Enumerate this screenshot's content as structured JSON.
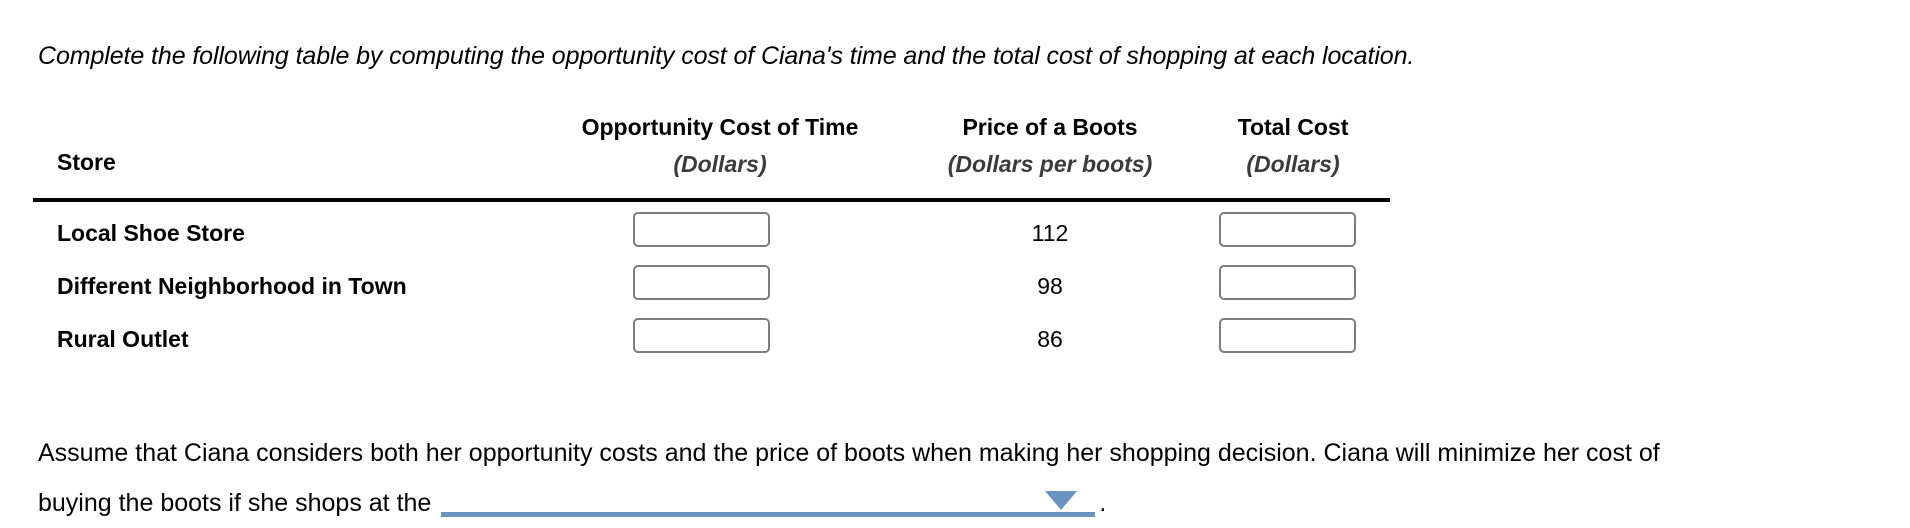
{
  "intro": {
    "text": "Complete the following table by computing the opportunity cost of Ciana's time and the total cost of shopping at each location."
  },
  "table": {
    "row_header_label": "Store",
    "columns": [
      {
        "title": "Opportunity Cost of Time",
        "subtitle": "(Dollars)",
        "type": "input"
      },
      {
        "title": "Price of a Boots",
        "subtitle": "(Dollars per boots)",
        "type": "value"
      },
      {
        "title": "Total Cost",
        "subtitle": "(Dollars)",
        "type": "input"
      }
    ],
    "rows": [
      {
        "store": "Local Shoe Store",
        "opportunity_cost": "",
        "opportunity_cost_placeholder": "",
        "price": "112",
        "total_cost": "",
        "total_cost_placeholder": ""
      },
      {
        "store": "Different Neighborhood in Town",
        "opportunity_cost": "",
        "opportunity_cost_placeholder": "",
        "price": "98",
        "total_cost": "",
        "total_cost_placeholder": ""
      },
      {
        "store": "Rural Outlet",
        "opportunity_cost": "",
        "opportunity_cost_placeholder": "",
        "price": "86",
        "total_cost": "",
        "total_cost_placeholder": ""
      }
    ]
  },
  "closing": {
    "line1": "Assume that Ciana considers both her opportunity costs and the price of boots when making her shopping decision. Ciana will minimize her cost of",
    "line2_before": "buying the boots if she shops at the",
    "dropdown_value": "",
    "dropdown_arrow_icon": "chevron-down-icon",
    "line2_after": "."
  },
  "colors": {
    "dropdown_accent": "#6b93c2",
    "input_border": "#7d7d7d",
    "rule": "#000000",
    "subheader_text": "#3b3b3b"
  }
}
